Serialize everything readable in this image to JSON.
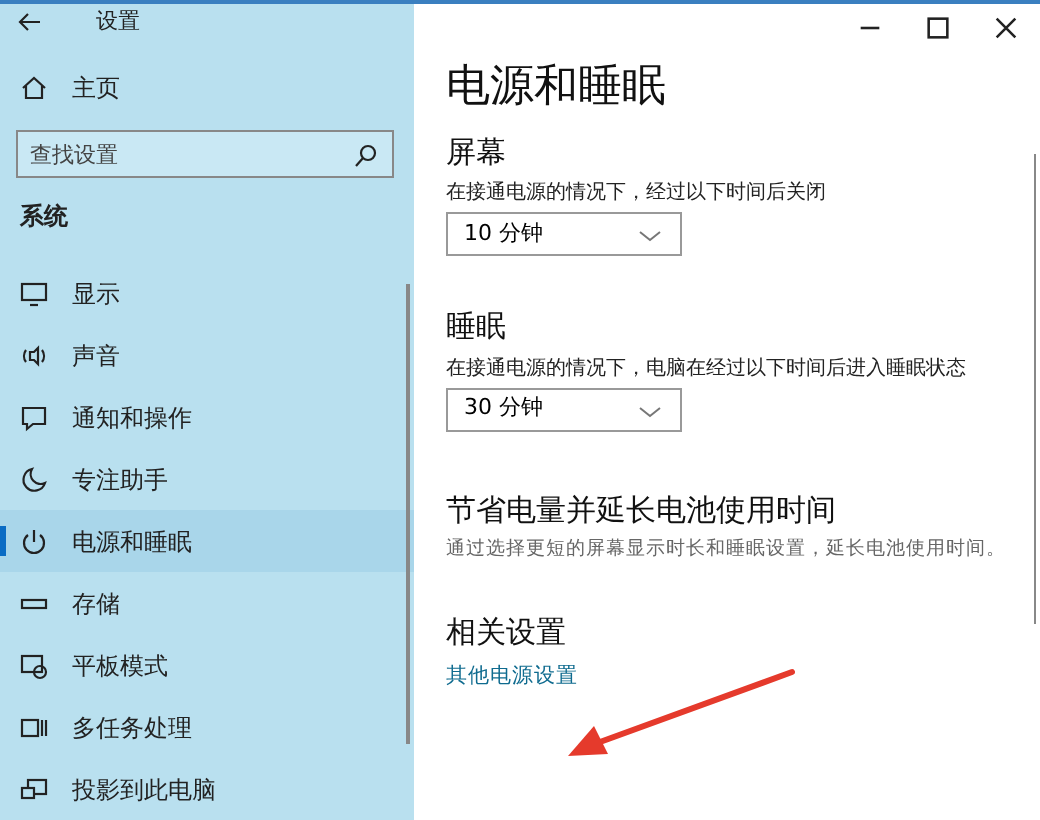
{
  "window": {
    "title": "设置"
  },
  "sidebar": {
    "home": "主页",
    "search": {
      "placeholder": "查找设置"
    },
    "section": "系统",
    "items": [
      {
        "label": "显示",
        "selected": false
      },
      {
        "label": "声音",
        "selected": false
      },
      {
        "label": "通知和操作",
        "selected": false
      },
      {
        "label": "专注助手",
        "selected": false
      },
      {
        "label": "电源和睡眠",
        "selected": true
      },
      {
        "label": "存储",
        "selected": false
      },
      {
        "label": "平板模式",
        "selected": false
      },
      {
        "label": "多任务处理",
        "selected": false
      },
      {
        "label": "投影到此电脑",
        "selected": false
      }
    ]
  },
  "page": {
    "title": "电源和睡眠",
    "sections": [
      {
        "kind": "dropdown",
        "heading": "屏幕",
        "label": "在接通电源的情况下，经过以下时间后关闭",
        "value": "10 分钟"
      },
      {
        "kind": "dropdown",
        "heading": "睡眠",
        "label": "在接通电源的情况下，电脑在经过以下时间后进入睡眠状态",
        "value": "30 分钟"
      },
      {
        "kind": "text",
        "heading": "节省电量并延长电池使用时间",
        "text": "通过选择更短的屏幕显示时长和睡眠设置，延长电池使用时间。"
      },
      {
        "kind": "links",
        "heading": "相关设置",
        "links": [
          "其他电源设置"
        ]
      }
    ]
  }
}
